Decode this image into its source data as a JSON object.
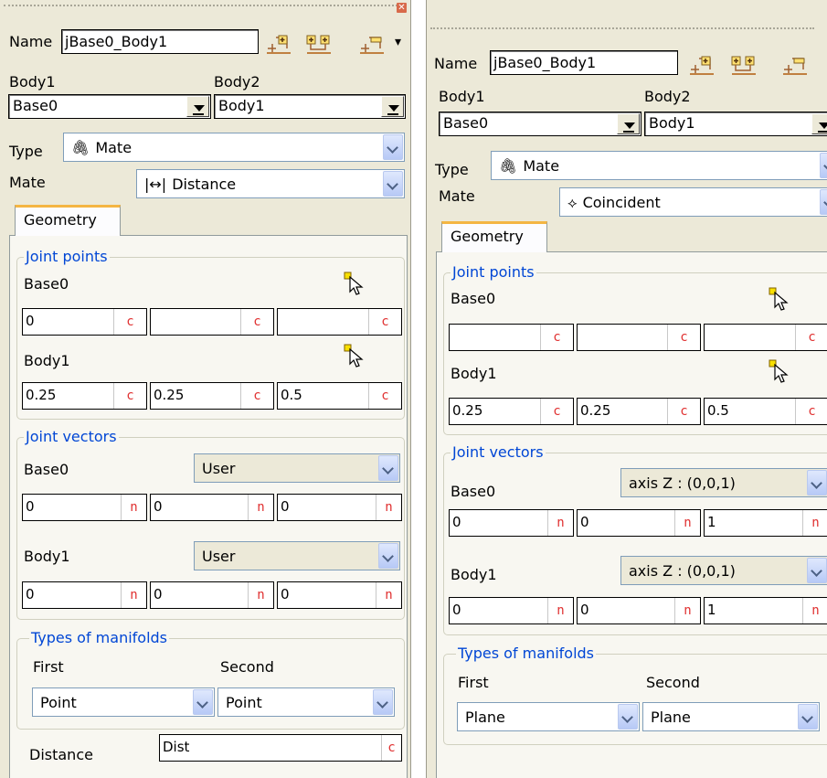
{
  "left": {
    "name_label": "Name",
    "name_value": "jBase0_Body1",
    "body1_label": "Body1",
    "body2_label": "Body2",
    "body1_value": "Base0",
    "body2_value": "Body1",
    "type_label": "Type",
    "type_value": "Mate",
    "mate_label": "Mate",
    "mate_value": "Distance",
    "tab_label": "Geometry",
    "joint_points": {
      "title": "Joint points",
      "base_label": "Base0",
      "base_values": [
        "0",
        "",
        ""
      ],
      "base_buttons": [
        "c",
        "c",
        "c"
      ],
      "body_label": "Body1",
      "body_values": [
        "0.25",
        "0.25",
        "0.5"
      ],
      "body_buttons": [
        "c",
        "c",
        "c"
      ]
    },
    "joint_vectors": {
      "title": "Joint vectors",
      "base_label": "Base0",
      "base_mode": "User",
      "base_values": [
        "0",
        "0",
        "0"
      ],
      "base_buttons": [
        "n",
        "n",
        "n"
      ],
      "body_label": "Body1",
      "body_mode": "User",
      "body_values": [
        "0",
        "0",
        "0"
      ],
      "body_buttons": [
        "n",
        "n",
        "n"
      ]
    },
    "manifolds": {
      "title": "Types of manifolds",
      "first_label": "First",
      "second_label": "Second",
      "first_value": "Point",
      "second_value": "Point"
    },
    "distance_label": "Distance",
    "distance_value": "Dist",
    "distance_button": "c"
  },
  "right": {
    "name_label": "Name",
    "name_value": "jBase0_Body1",
    "body1_label": "Body1",
    "body2_label": "Body2",
    "body1_value": "Base0",
    "body2_value": "Body1",
    "type_label": "Type",
    "type_value": "Mate",
    "mate_label": "Mate",
    "mate_value": "Coincident",
    "tab_label": "Geometry",
    "joint_points": {
      "title": "Joint points",
      "base_label": "Base0",
      "base_values": [
        "",
        "",
        ""
      ],
      "base_buttons": [
        "c",
        "c",
        "c"
      ],
      "body_label": "Body1",
      "body_values": [
        "0.25",
        "0.25",
        "0.5"
      ],
      "body_buttons": [
        "c",
        "c",
        "c"
      ]
    },
    "joint_vectors": {
      "title": "Joint vectors",
      "base_label": "Base0",
      "base_mode": "axis Z : (0,0,1)",
      "base_values": [
        "0",
        "0",
        "1"
      ],
      "base_buttons": [
        "n",
        "n",
        "n"
      ],
      "body_label": "Body1",
      "body_mode": "axis Z : (0,0,1)",
      "body_values": [
        "0",
        "0",
        "1"
      ],
      "body_buttons": [
        "n",
        "n",
        "n"
      ]
    },
    "manifolds": {
      "title": "Types of manifolds",
      "first_label": "First",
      "second_label": "Second",
      "first_value": "Plane",
      "second_value": "Plane"
    }
  },
  "icons": [
    "add-joint-icon",
    "add-multi-joint-icon",
    "remove-joint-icon",
    "overflow-chevron-icon",
    "select-point-icon",
    "close-icon",
    "paperclip-icon",
    "distance-icon",
    "coincident-icon"
  ],
  "colors": {
    "accent_tab": "#f4b542",
    "group_title": "#0046d5",
    "coord_button": "#e03030",
    "panel_bg": "#ece9d8"
  }
}
